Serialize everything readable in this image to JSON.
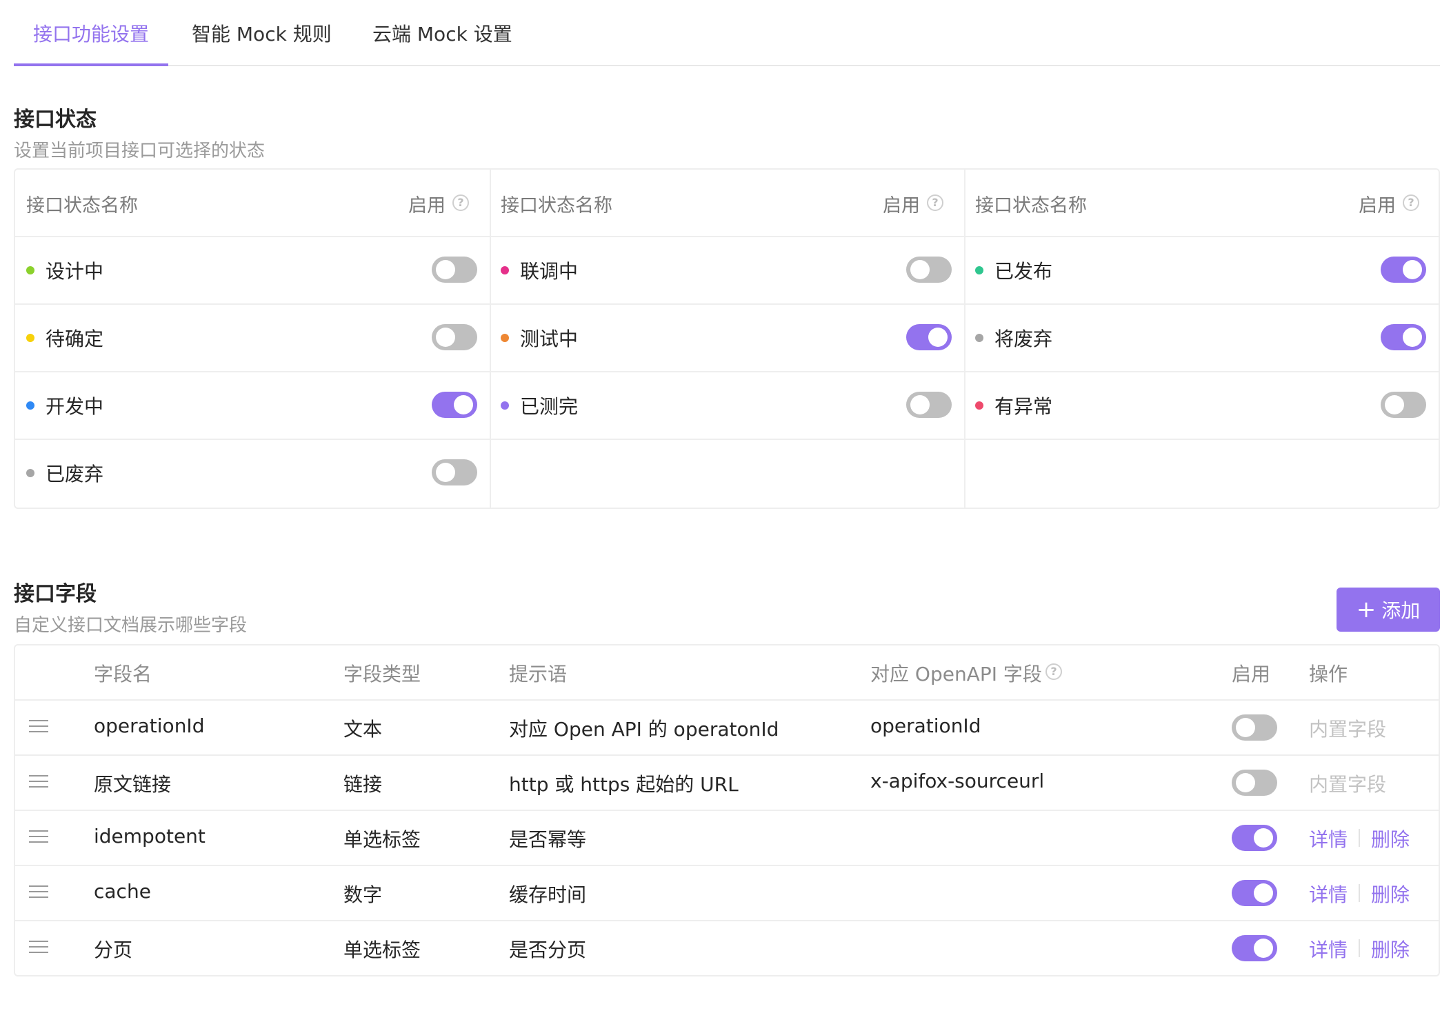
{
  "tabs": [
    {
      "label": "接口功能设置"
    },
    {
      "label": "智能 Mock 规则"
    },
    {
      "label": "云端 Mock 设置"
    }
  ],
  "status_section": {
    "title": "接口状态",
    "desc": "设置当前项目接口可选择的状态",
    "col_name": "接口状态名称",
    "col_enable": "启用",
    "help": "?",
    "items": [
      {
        "label": "设计中",
        "color": "#8bd12c",
        "enabled": false
      },
      {
        "label": "待确定",
        "color": "#f7d10a",
        "enabled": false
      },
      {
        "label": "开发中",
        "color": "#2f89f5",
        "enabled": true
      },
      {
        "label": "已废弃",
        "color": "#a6a6a6",
        "enabled": false
      },
      {
        "label": "联调中",
        "color": "#e5308a",
        "enabled": false
      },
      {
        "label": "测试中",
        "color": "#ee8733",
        "enabled": true
      },
      {
        "label": "已测完",
        "color": "#9373ee",
        "enabled": false
      },
      {
        "label": "已发布",
        "color": "#2fc68f",
        "enabled": true
      },
      {
        "label": "将废弃",
        "color": "#a6a6a6",
        "enabled": true
      },
      {
        "label": "有异常",
        "color": "#ee4a6c",
        "enabled": false
      }
    ]
  },
  "fields_section": {
    "title": "接口字段",
    "desc": "自定义接口文档展示哪些字段",
    "add_label": "添加",
    "add_icon": "+",
    "headers": {
      "name": "字段名",
      "type": "字段类型",
      "hint": "提示语",
      "openapi": "对应 OpenAPI 字段",
      "enable": "启用",
      "action": "操作"
    },
    "rows": [
      {
        "name": "operationId",
        "type": "文本",
        "hint": "对应 Open API 的 operatonId",
        "openapi": "operationId",
        "enabled": false,
        "builtin": "内置字段"
      },
      {
        "name": "原文链接",
        "type": "链接",
        "hint": "http 或 https 起始的 URL",
        "openapi": "x-apifox-sourceurl",
        "enabled": false,
        "builtin": "内置字段"
      },
      {
        "name": "idempotent",
        "type": "单选标签",
        "hint": "是否幂等",
        "openapi": "",
        "enabled": true,
        "detail": "详情",
        "delete": "删除"
      },
      {
        "name": "cache",
        "type": "数字",
        "hint": "缓存时间",
        "openapi": "",
        "enabled": true,
        "detail": "详情",
        "delete": "删除"
      },
      {
        "name": "分页",
        "type": "单选标签",
        "hint": "是否分页",
        "openapi": "",
        "enabled": true,
        "detail": "详情",
        "delete": "删除"
      }
    ]
  },
  "colors": {
    "accent": "#9373ee",
    "toggle_off": "#bfbfbf"
  }
}
